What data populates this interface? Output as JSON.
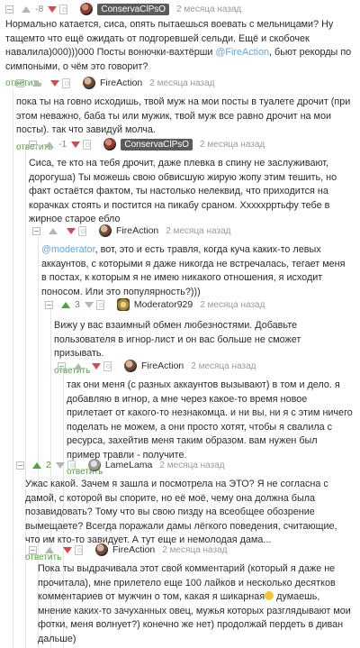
{
  "ui": {
    "reply_label": "ответить"
  },
  "c0": {
    "text_1": "Нормально катается, сиса, опять пытаешься воевать с мельницами? Ну тащемто что ещё ожидать от подгоревшей сельди. Ещё и скобочек навалила)000)))000 Посты вонючки-вахтёрши ",
    "mention": "@FireAction",
    "text_2": ", бьют рекорды по симпоными, о чём это говорит?"
  },
  "c1": {
    "user": "FireAction",
    "time": "2 месяца назад",
    "rating": "",
    "text": "пока ты на говно исходишь, твой муж на мои посты в туалете дрочит (при этом неважно, баба ты или мужик, твой муж все равно дрочит на мои посты). так что завидуй молча."
  },
  "c2": {
    "user": "ConservaClPsO",
    "time": "2 месяца назад",
    "rating": "-1",
    "text": "Сиса, те кто на тебя дрочит, даже плевка в спину не заслуживают, дорогуша) Ты можешь свою обвисшую жирую жопу этим тешить, но факт остаётся фактом, ты настолько нелеквид, что приходится на корачках стоять и постится на пикабу сраном. Хххххрртьфу тебе в жирное старое ебло"
  },
  "c3": {
    "user": "FireAction",
    "time": "2 месяца назад",
    "mention": "@moderator",
    "text": ", вот, это и есть травля, когда куча каких-то левых аккаунтов, с которыми я даже никогда не встречалась, тегает меня в постах, к которым я не имею никакого отношения, я исходит поносом. Или это популярность?)))"
  },
  "c4": {
    "user": "Moderator929",
    "time": "2 месяца назад",
    "rating": "3",
    "text": "Вижу у вас взаимный обмен любезностями. Добавьте пользователя в игнор-лист и он вас больше не сможет призывать."
  },
  "c5": {
    "user": "FireAction",
    "time": "2 месяца назад",
    "text": "так они меня (с разных аккаунтов вызывают) в том и дело. я добавляю в игнор, а мне через какое-то время новое прилетает от какого-то незнакомца. и ни вы, ни я с этим ничего поделать не можем, а они просто хотят, чтобы я свалила с ресурса, захейтив меня таким образом. вам нужен был пример травли - получите."
  },
  "c6": {
    "user": "LameLama",
    "time": "2 месяца назад",
    "rating": "2",
    "text": "Ужас какой. Зачем я зашла и посмотрела на ЭТО? Я не согласна с дамой, с которой вы спорите, но её моё, чему она должна была позавидовать? Тому что вы свою пизду на всеобщее обозрение вымещаете? Всегда поражали дамы лёгкого поведения, считающие, что им кто-то завидует. А тут еще и немолодая дама..."
  },
  "c7": {
    "user": "FireAction",
    "time": "2 месяца назад",
    "text_1": "Пока ты выдрачивала этот свой комментарий (который я даже не прочитала), мне прилетело еще 100 лайков и несколько десятков комментариев от мужчин о том, какая я шикарная",
    "text_2": " думаешь, мнение каких-то зачуханных овец, мужья которых разглядывают мои фотки, меня волнует?) конечно же нет) продолжай пердеть в диван дальше)"
  },
  "top_header": {
    "rating": "-8",
    "user": "ConservaClPsO",
    "time": "2 месяца назад"
  }
}
